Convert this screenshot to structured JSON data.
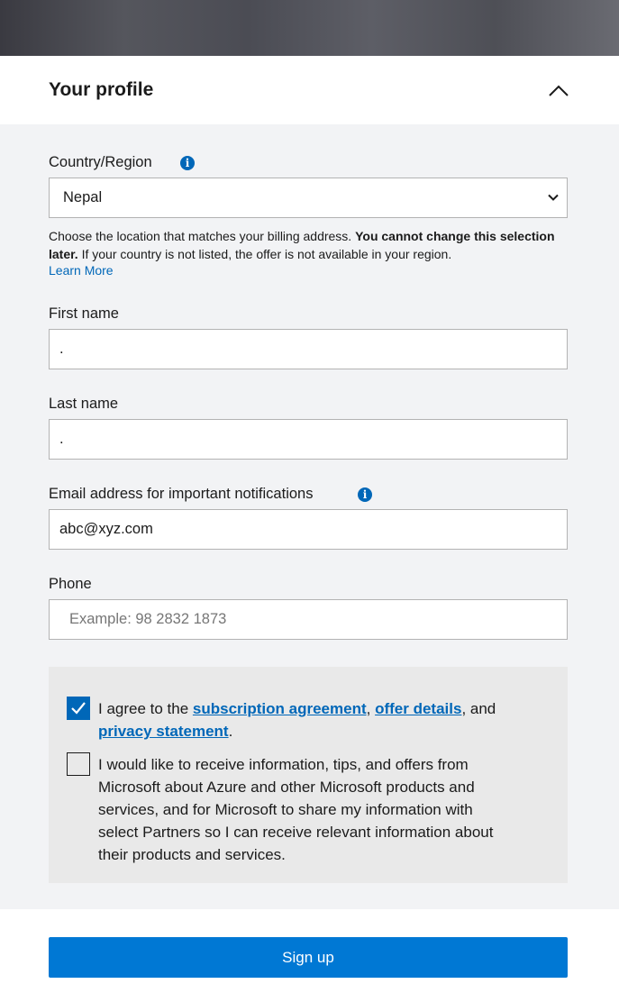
{
  "section": {
    "title": "Your profile",
    "toggle_icon": "chevron-up-icon"
  },
  "country": {
    "label": "Country/Region",
    "info_glyph": "i",
    "selected": "Nepal",
    "help_prefix": "Choose the location that matches your billing address. ",
    "help_bold": "You cannot change this selection later.",
    "help_suffix": " If your country is not listed, the offer is not available in your region.",
    "learn_more": "Learn More"
  },
  "first_name": {
    "label": "First name",
    "value": "."
  },
  "last_name": {
    "label": "Last name",
    "value": "."
  },
  "email": {
    "label": "Email address for important notifications",
    "info_glyph": "i",
    "value": "abc@xyz.com"
  },
  "phone": {
    "label": "Phone",
    "placeholder": "Example: 98 2832 1873",
    "value": ""
  },
  "agreement": {
    "checked": true,
    "prefix": "I agree to the ",
    "link1": "subscription agreement",
    "sep1": ", ",
    "link2": "offer details",
    "sep2": ", and",
    "link3": "privacy statement",
    "suffix": "."
  },
  "marketing": {
    "checked": false,
    "line1": "I would like to receive information, tips, and offers from",
    "line2": "Microsoft about Azure and other Microsoft products and",
    "line3": "services, and for Microsoft to share my information with",
    "line4": "select Partners so I can receive relevant information about",
    "line5": "their products and services."
  },
  "signup": {
    "label": "Sign up"
  },
  "colors": {
    "accent": "#0067b8",
    "button": "#0078d4",
    "form_background": "#f2f3f5",
    "consent_background": "#e9e9e9"
  }
}
